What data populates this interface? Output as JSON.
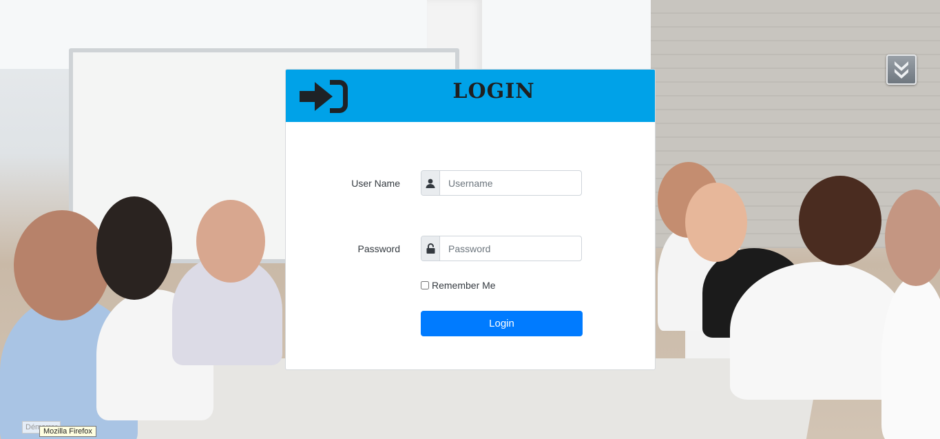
{
  "login": {
    "title": "LOGIN",
    "username_label": "User Name",
    "username_placeholder": "Username",
    "username_value": "",
    "password_label": "Password",
    "password_placeholder": "Password",
    "password_value": "",
    "remember_label": "Remember Me",
    "remember_checked": false,
    "submit_label": "Login"
  },
  "icons": {
    "header": "sign-in-icon",
    "username": "user-icon",
    "password": "unlock-icon",
    "scroll": "scroll-down-icon"
  },
  "taskbar": {
    "start_tooltip": "Démarrer",
    "app_tooltip": "Mozilla Firefox"
  },
  "colors": {
    "header": "#00a2e8",
    "button": "#007bff",
    "title": "#1f1f1f"
  }
}
